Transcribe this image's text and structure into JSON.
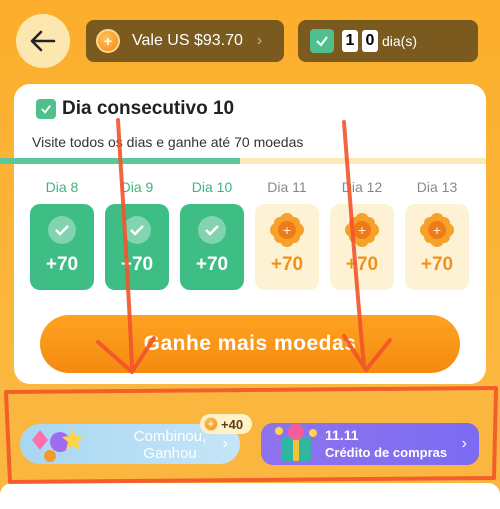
{
  "header": {
    "back_icon": "back-arrow-icon",
    "balance_label": "Vale US $93.70",
    "balance_icon": "coin-icon",
    "streak_digits": [
      "1",
      "0"
    ],
    "streak_unit": "dia(s)",
    "streak_icon": "calendar-check-icon"
  },
  "card": {
    "title": "Dia consecutivo 10",
    "subtitle": "Visite todos os dias e ganhe até 70 moedas",
    "days": [
      {
        "label": "Dia 8",
        "reward": "+70",
        "status": "done"
      },
      {
        "label": "Dia 9",
        "reward": "+70",
        "status": "done"
      },
      {
        "label": "Dia 10",
        "reward": "+70",
        "status": "done"
      },
      {
        "label": "Dia 11",
        "reward": "+70",
        "status": "todo"
      },
      {
        "label": "Dia 12",
        "reward": "+70",
        "status": "todo"
      },
      {
        "label": "Dia 13",
        "reward": "+70",
        "status": "todo"
      }
    ],
    "cta_label": "Ganhe mais moedas"
  },
  "promos": {
    "left_text": "Combinou, Ganhou",
    "left_badge": "+40",
    "right_line1": "11.11",
    "right_line2": "Crédito de compras"
  },
  "colors": {
    "background": "#fbb640",
    "done_green": "#3ebd85",
    "accent_orange": "#f48a10",
    "annotation": "#f2542a"
  }
}
